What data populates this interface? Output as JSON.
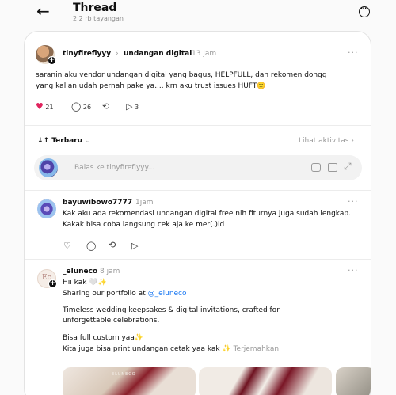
{
  "header": {
    "title": "Thread",
    "views": "2,2 rb tayangan"
  },
  "post": {
    "username": "tinyfireflyyy",
    "community": "undangan digital",
    "time": "13 jam",
    "text_line1": "saranin aku vendor undangan digital yang bagus, HELPFULL, dan rekomen dongg",
    "text_line2": "yang kalian udah pernah pake ya.... krn aku trust issues HUFT🙂",
    "likes": "21",
    "replies": "26",
    "shares": "3"
  },
  "sort": {
    "label": "Terbaru",
    "activity_link": "Lihat aktivitas"
  },
  "reply_box": {
    "placeholder": "Balas ke tinyfireflyyy..."
  },
  "comments": [
    {
      "username": "bayuwibowo7777",
      "time": "1jam",
      "line1": "Kak aku ada rekomendasi undangan digital free nih fiturnya juga sudah lengkap.",
      "line2": "Kakak bisa coba langsung cek aja ke mer(.)id"
    },
    {
      "username": "_eluneco",
      "time": "8 jam",
      "line1": "Hii kak 🤍✨",
      "line2_prefix": "Sharing our portfolio at ",
      "mention": "@_eluneco",
      "line3": "Timeless wedding keepsakes & digital invitations, crafted for",
      "line4": "unforgettable celebrations.",
      "line5": "Bisa full custom yaa✨",
      "line6": "Kita juga bisa print undangan cetak yaa kak ✨",
      "translate": "Terjemahkan",
      "image_caption": "ELUNECO"
    }
  ],
  "colors": {
    "like_red": "#e0245e",
    "mention_blue": "#1877f2",
    "muted": "#999999"
  }
}
